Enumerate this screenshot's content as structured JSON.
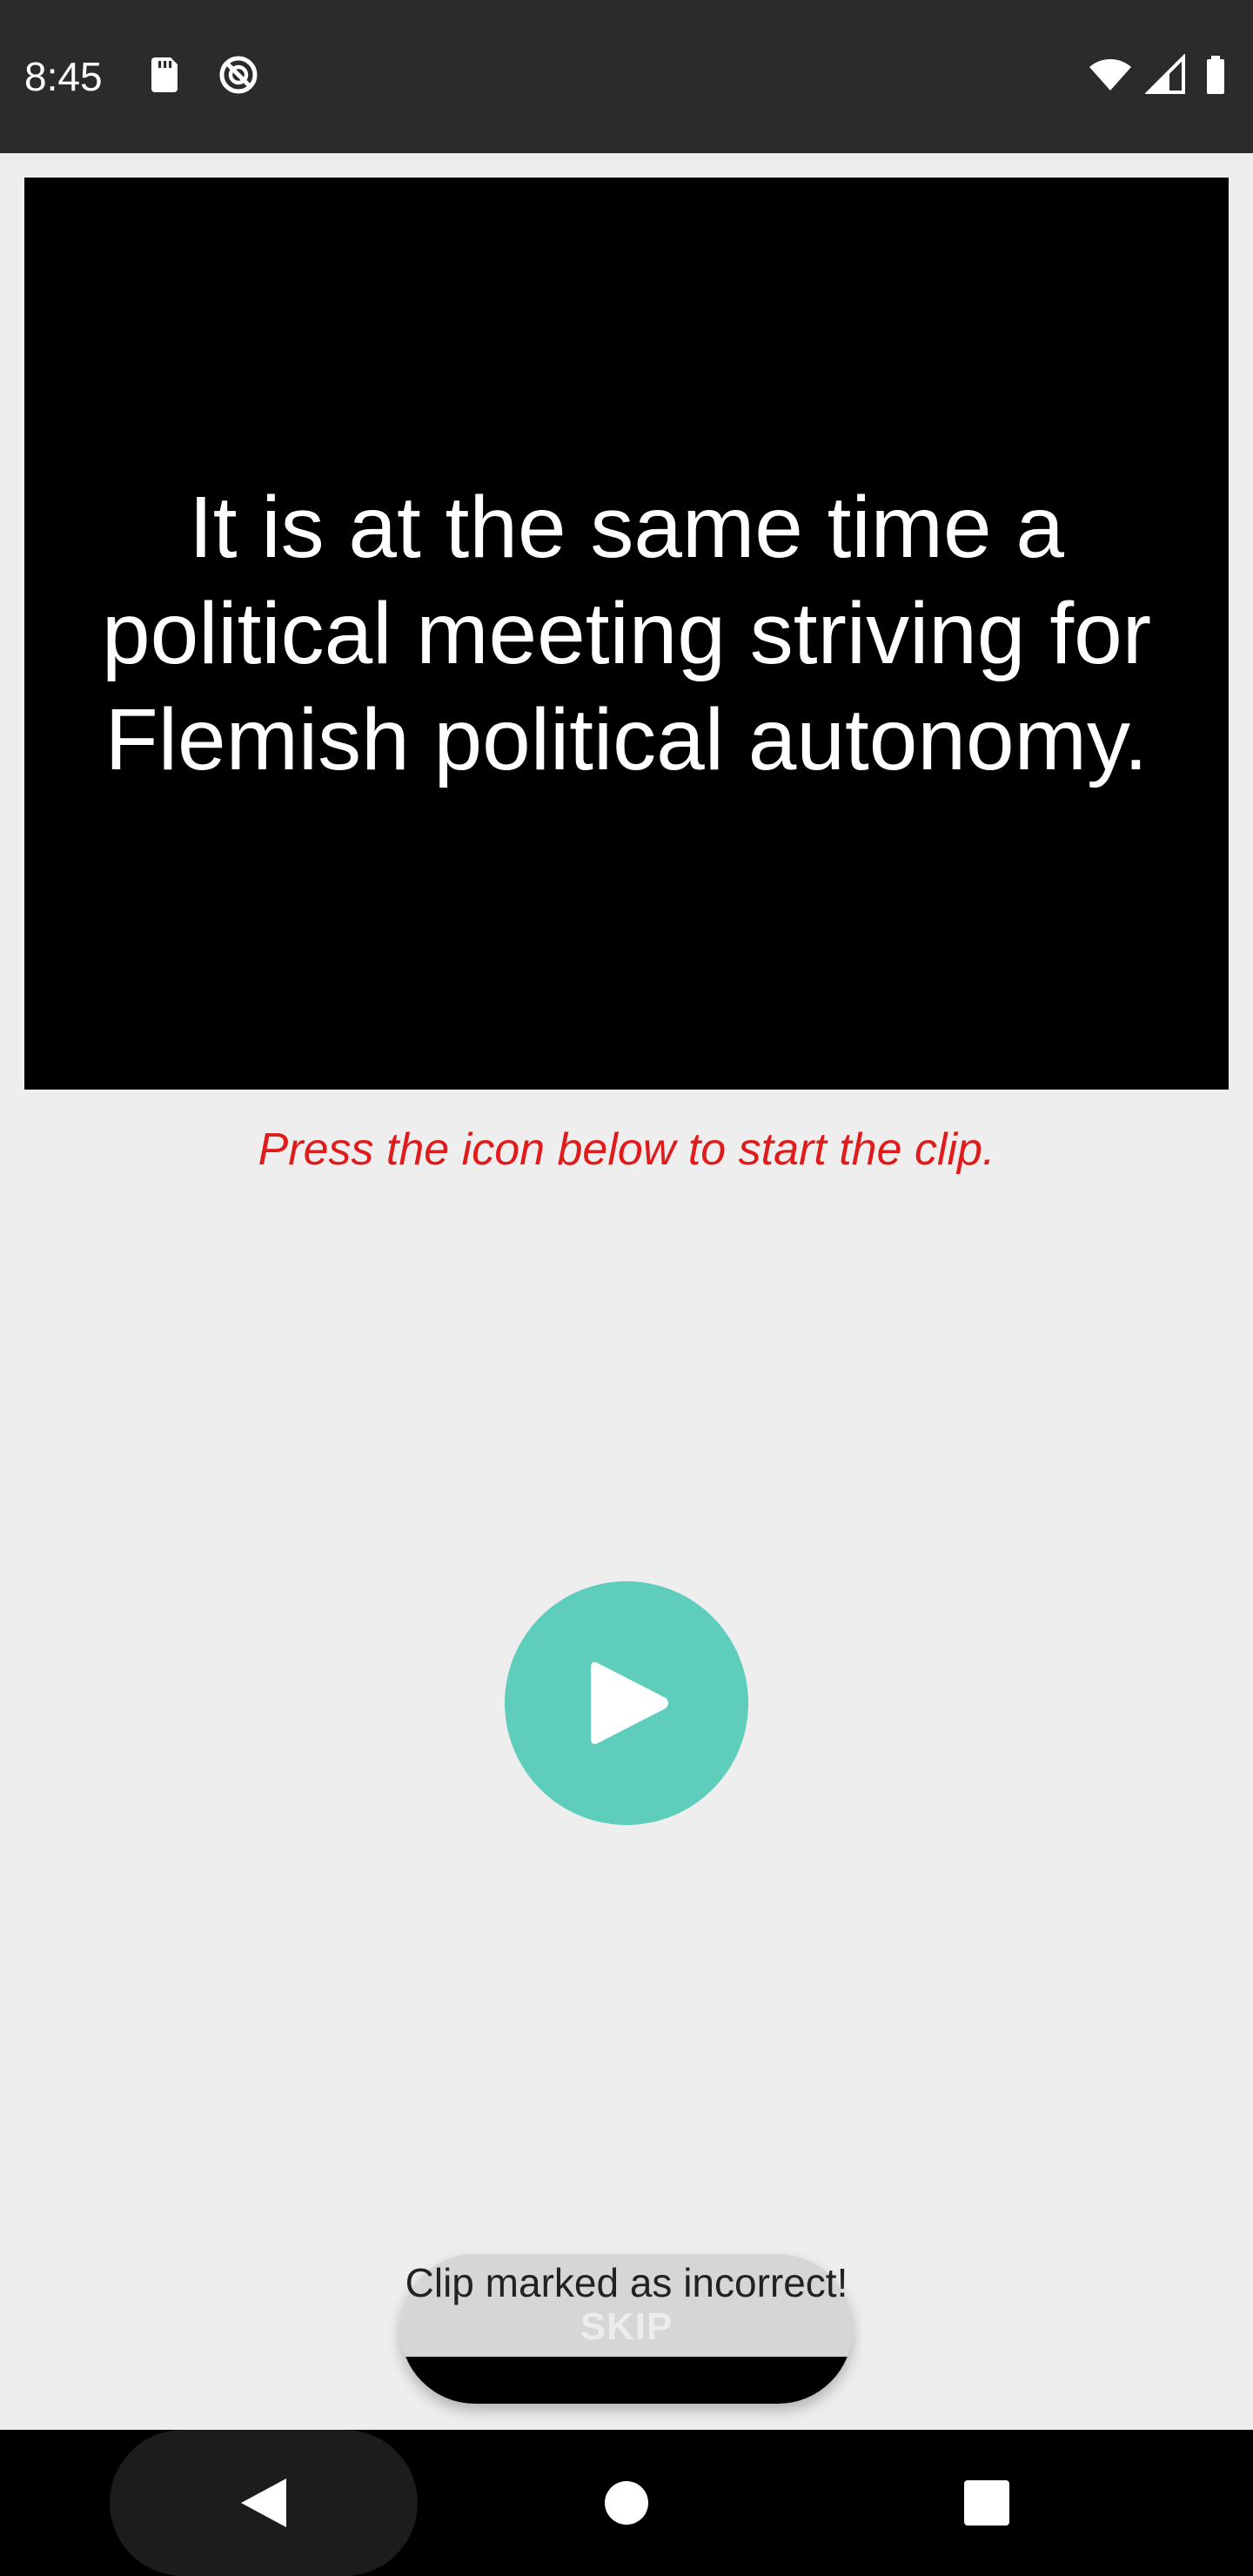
{
  "status_bar": {
    "time": "8:45",
    "left_icons": [
      "sd-card-icon",
      "do-not-disturb-icon"
    ],
    "right_icons": [
      "wifi-icon",
      "cell-signal-icon",
      "battery-icon"
    ]
  },
  "sentence": {
    "text": "It is at the same time a political meeting striving for Flemish political autonomy."
  },
  "hint": {
    "text": "Press the icon below to start the clip."
  },
  "player": {
    "icon": "play-icon",
    "accent_color": "#5ecdbb"
  },
  "actions": {
    "skip_label": "SKIP"
  },
  "toast": {
    "text": "Clip marked as incorrect!"
  },
  "nav_bar": {
    "buttons": [
      "back-icon",
      "home-icon",
      "recents-icon"
    ]
  },
  "colors": {
    "background": "#eeeeee",
    "hint": "#e01b1b",
    "status_bar": "#2b2b2b"
  }
}
